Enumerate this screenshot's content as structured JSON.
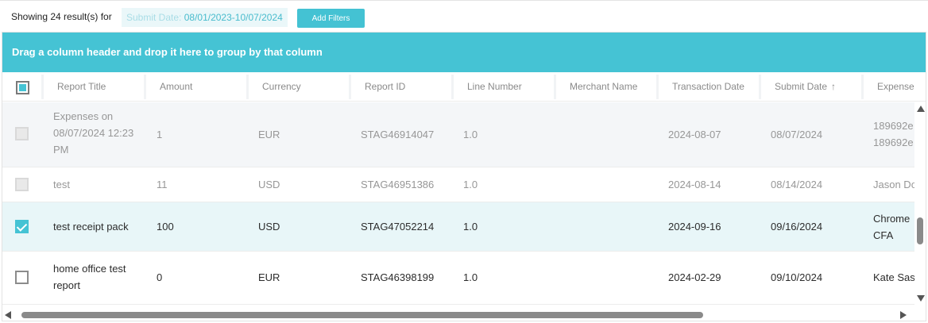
{
  "summary": {
    "results_text": "Showing 24 result(s) for",
    "filter_key": "Submit Date:",
    "filter_value": "08/01/2023-10/07/2024",
    "add_filters_label": "Add Filters"
  },
  "grid": {
    "group_panel_text": "Drag a column header and drop it here to group by that column",
    "columns": [
      "Report Title",
      "Amount",
      "Currency",
      "Report ID",
      "Line Number",
      "Merchant Name",
      "Transaction Date",
      "Submit Date",
      "Expense"
    ],
    "sort": {
      "column": "Submit Date",
      "direction": "ascending",
      "indicator": "↑"
    },
    "header_checkbox_state": "partial",
    "rows": [
      {
        "state": "disabled",
        "report_title": "Expenses on 08/07/2024 12:23 PM",
        "amount": "1",
        "currency": "EUR",
        "report_id": "STAG46914047",
        "line_number": "1.0",
        "merchant_name": "",
        "transaction_date": "2024-08-07",
        "submit_date": "08/07/2024",
        "expense": "189692e 189692e"
      },
      {
        "state": "disabled",
        "report_title": "test",
        "amount": "11",
        "currency": "USD",
        "report_id": "STAG46951386",
        "line_number": "1.0",
        "merchant_name": "",
        "transaction_date": "2024-08-14",
        "submit_date": "08/14/2024",
        "expense": "Jason Do"
      },
      {
        "state": "checked",
        "report_title": "test receipt pack",
        "amount": "100",
        "currency": "USD",
        "report_id": "STAG47052214",
        "line_number": "1.0",
        "merchant_name": "",
        "transaction_date": "2024-09-16",
        "submit_date": "09/16/2024",
        "expense": "Chrome CFA"
      },
      {
        "state": "unchecked",
        "report_title": "home office test report",
        "amount": "0",
        "currency": "EUR",
        "report_id": "STAG46398199",
        "line_number": "1.0",
        "merchant_name": "",
        "transaction_date": "2024-02-29",
        "submit_date": "09/10/2024",
        "expense": "Kate Sas"
      }
    ]
  },
  "colors": {
    "accent": "#45c3d4",
    "selected_row": "#e8f6f8",
    "disabled_row": "#f4f6f8"
  }
}
